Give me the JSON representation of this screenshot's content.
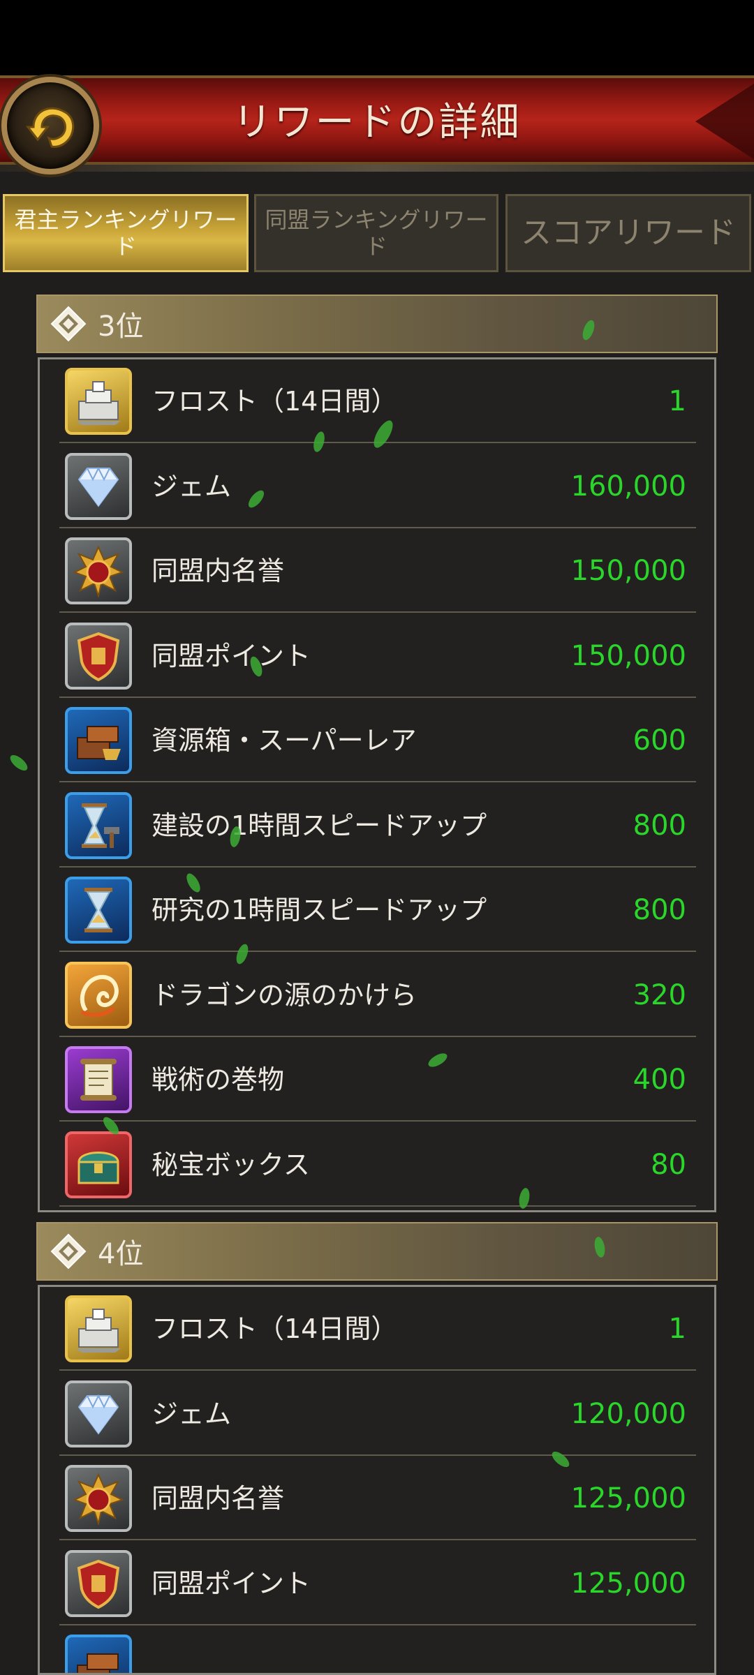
{
  "header": {
    "title": "リワードの詳細",
    "back_icon": "back-arrow-icon"
  },
  "tabs": [
    {
      "label": "君主ランキングリワード",
      "active": true
    },
    {
      "label": "同盟ランキングリワード",
      "active": false
    },
    {
      "label": "スコアリワード",
      "active": false
    }
  ],
  "sections": [
    {
      "rank": "3位",
      "rewards": [
        {
          "name": "フロスト（14日間）",
          "value": "1",
          "icon": "fortress-icon",
          "frame": "gold"
        },
        {
          "name": "ジェム",
          "value": "160,000",
          "icon": "gem-icon",
          "frame": "silver"
        },
        {
          "name": "同盟内名誉",
          "value": "150,000",
          "icon": "honor-medal-icon",
          "frame": "silver"
        },
        {
          "name": "同盟ポイント",
          "value": "150,000",
          "icon": "alliance-shield-icon",
          "frame": "silver"
        },
        {
          "name": "資源箱・スーパーレア",
          "value": "600",
          "icon": "resource-box-icon",
          "frame": "blue"
        },
        {
          "name": "建設の1時間スピードアップ",
          "value": "800",
          "icon": "hourglass-hammer-icon",
          "frame": "blue"
        },
        {
          "name": "研究の1時間スピードアップ",
          "value": "800",
          "icon": "hourglass-icon",
          "frame": "blue"
        },
        {
          "name": "ドラゴンの源のかけら",
          "value": "320",
          "icon": "dragon-shard-icon",
          "frame": "orange"
        },
        {
          "name": "戦術の巻物",
          "value": "400",
          "icon": "scroll-icon",
          "frame": "purple"
        },
        {
          "name": "秘宝ボックス",
          "value": "80",
          "icon": "treasure-chest-icon",
          "frame": "red"
        }
      ]
    },
    {
      "rank": "4位",
      "rewards": [
        {
          "name": "フロスト（14日間）",
          "value": "1",
          "icon": "fortress-icon",
          "frame": "gold"
        },
        {
          "name": "ジェム",
          "value": "120,000",
          "icon": "gem-icon",
          "frame": "silver"
        },
        {
          "name": "同盟内名誉",
          "value": "125,000",
          "icon": "honor-medal-icon",
          "frame": "silver"
        },
        {
          "name": "同盟ポイント",
          "value": "125,000",
          "icon": "alliance-shield-icon",
          "frame": "silver"
        },
        {
          "name": "",
          "value": "",
          "icon": "resource-box-icon",
          "frame": "blue"
        }
      ]
    }
  ],
  "colors": {
    "value_green": "#2bd62b",
    "header_red": "#b5241a",
    "tab_gold": "#d9b746"
  }
}
